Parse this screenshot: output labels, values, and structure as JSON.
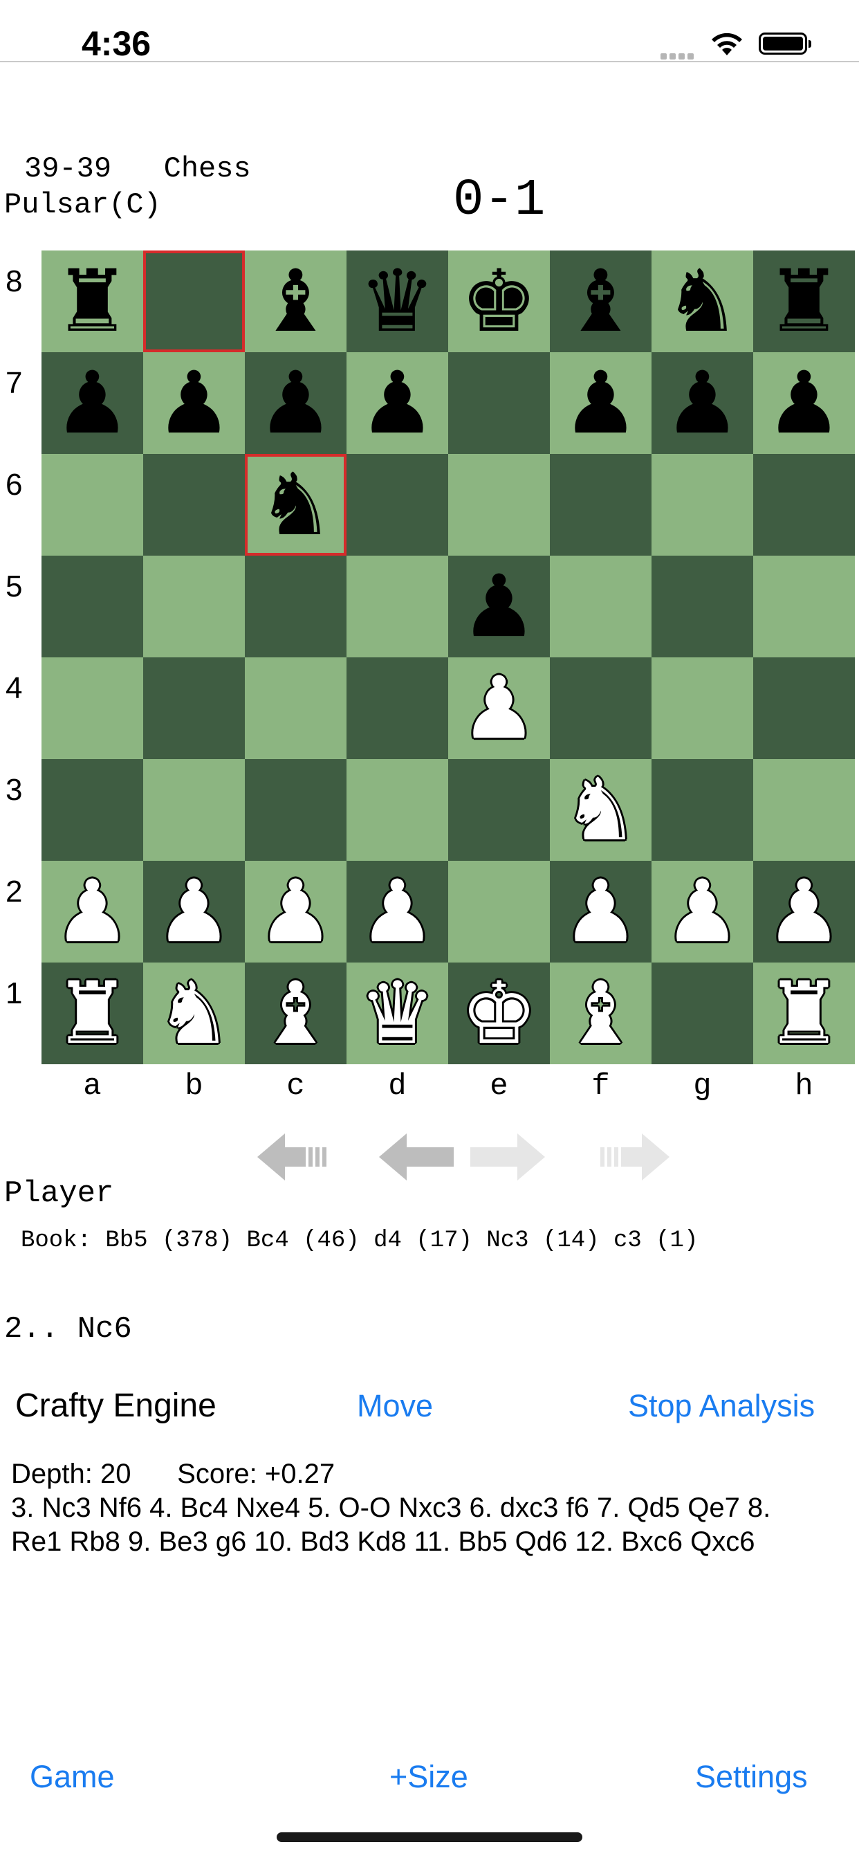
{
  "status_bar": {
    "time": "4:36"
  },
  "header": {
    "title": "39-39   Chess",
    "player": "Pulsar(C)",
    "result": "0-1"
  },
  "board": {
    "ranks": [
      "8",
      "7",
      "6",
      "5",
      "4",
      "3",
      "2",
      "1"
    ],
    "files": [
      "a",
      "b",
      "c",
      "d",
      "e",
      "f",
      "g",
      "h"
    ],
    "position": [
      [
        "bR",
        "",
        "bB",
        "bQ",
        "bK",
        "bB",
        "bN",
        "bR"
      ],
      [
        "bP",
        "bP",
        "bP",
        "bP",
        "",
        "bP",
        "bP",
        "bP"
      ],
      [
        "",
        "",
        "bN",
        "",
        "",
        "",
        "",
        ""
      ],
      [
        "",
        "",
        "",
        "",
        "bP",
        "",
        "",
        ""
      ],
      [
        "",
        "",
        "",
        "",
        "wP",
        "",
        "",
        ""
      ],
      [
        "",
        "",
        "",
        "",
        "",
        "wN",
        "",
        ""
      ],
      [
        "wP",
        "wP",
        "wP",
        "wP",
        "",
        "wP",
        "wP",
        "wP"
      ],
      [
        "wR",
        "wN",
        "wB",
        "wQ",
        "wK",
        "wB",
        "",
        "wR"
      ]
    ],
    "highlight_squares": [
      "b8",
      "c6"
    ]
  },
  "turn_label": "Player",
  "book": "Book: Bb5 (378) Bc4 (46) d4 (17) Nc3 (14) c3 (1)",
  "last_move": "2.. Nc6",
  "engine": {
    "name": "Crafty Engine",
    "move_label": "Move",
    "stop_label": "Stop Analysis",
    "depth": "Depth: 20",
    "score": "Score: +0.27",
    "pv_line1": "3. Nc3 Nf6 4. Bc4 Nxe4 5. O-O Nxc3 6. dxc3 f6 7. Qd5 Qe7 8.",
    "pv_line2": "Re1 Rb8 9. Be3 g6 10. Bd3 Kd8 11. Bb5 Qd6 12. Bxc6 Qxc6"
  },
  "toolbar": {
    "game_label": "Game",
    "size_label": "+Size",
    "settings_label": "Settings"
  }
}
